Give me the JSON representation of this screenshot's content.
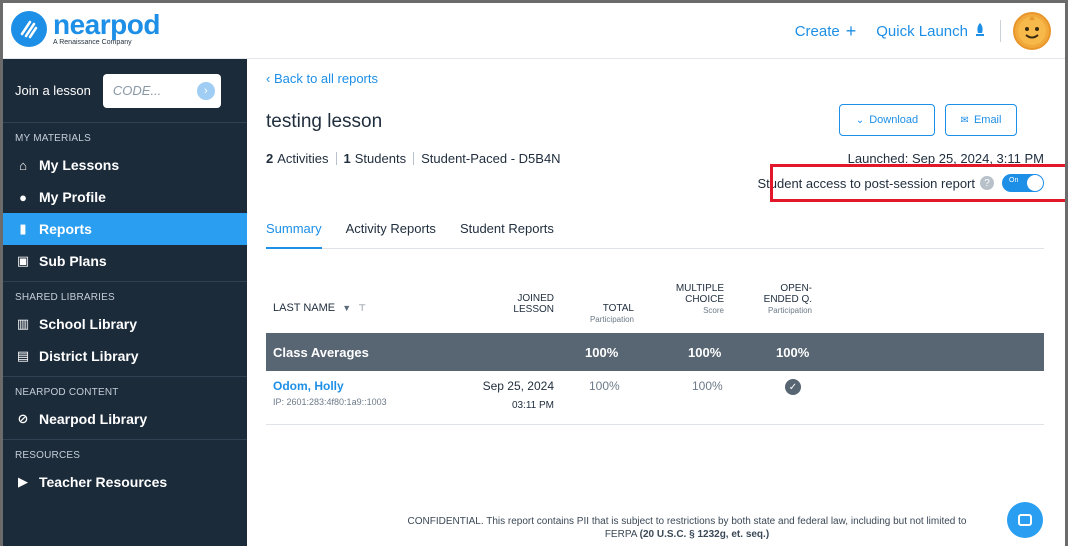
{
  "header": {
    "logo_word": "nearpod",
    "logo_sub": "A Renaissance Company",
    "create_label": "Create",
    "create_icon": "+",
    "quick_launch_label": "Quick Launch",
    "avatar_icon": "emoji-face"
  },
  "sidebar": {
    "join_label": "Join a lesson",
    "join_placeholder": "CODE...",
    "sections": {
      "my_materials": "MY MATERIALS",
      "shared_libraries": "SHARED LIBRARIES",
      "nearpod_content": "NEARPOD CONTENT",
      "resources": "RESOURCES"
    },
    "items": {
      "my_lessons": "My Lessons",
      "my_profile": "My Profile",
      "reports": "Reports",
      "sub_plans": "Sub Plans",
      "school_library": "School Library",
      "district_library": "District Library",
      "nearpod_library": "Nearpod Library",
      "teacher_resources": "Teacher Resources"
    },
    "active_item": "reports"
  },
  "report": {
    "back_label": "Back to all reports",
    "title": "testing lesson",
    "activities_count": "2",
    "activities_label": "Activities",
    "students_count": "1",
    "students_label": "Students",
    "mode": "Student-Paced - D5B4N",
    "download_label": "Download",
    "email_label": "Email",
    "launched": "Launched: Sep 25, 2024, 3:11 PM",
    "student_access_label": "Student access to post-session report",
    "toggle_label": "On",
    "toggle_on": true
  },
  "tabs": [
    "Summary",
    "Activity Reports",
    "Student Reports"
  ],
  "active_tab": 0,
  "table": {
    "col_last_name": "LAST NAME",
    "col_joined_1": "JOINED",
    "col_joined_2": "LESSON",
    "col_total_1": "TOTAL",
    "col_total_sub": "Participation",
    "col_mc_1": "MULTIPLE",
    "col_mc_2": "CHOICE",
    "col_mc_sub": "Score",
    "col_oe_1": "OPEN-",
    "col_oe_2": "ENDED Q.",
    "col_oe_sub": "Participation",
    "averages": {
      "label": "Class Averages",
      "total": "100%",
      "mc": "100%",
      "oe": "100%"
    },
    "rows": [
      {
        "name": "Odom, Holly",
        "ip": "IP: 2601:283:4f80:1a9::1003",
        "joined_date": "Sep 25, 2024",
        "joined_time": "03:11 PM",
        "total": "100%",
        "mc": "100%",
        "oe_done": true
      }
    ]
  },
  "footer": {
    "text": "CONFIDENTIAL. This report contains PII that is subject to restrictions by both state and federal law, including but not limited to FERPA",
    "citation": "(20 U.S.C. § 1232g, et. seq.)"
  },
  "colors": {
    "brand": "#1d8fe6",
    "sidebar_bg": "#1c2b3a",
    "active_nav": "#2a9ef0",
    "avg_row": "#586573",
    "highlight": "#e2172a"
  }
}
